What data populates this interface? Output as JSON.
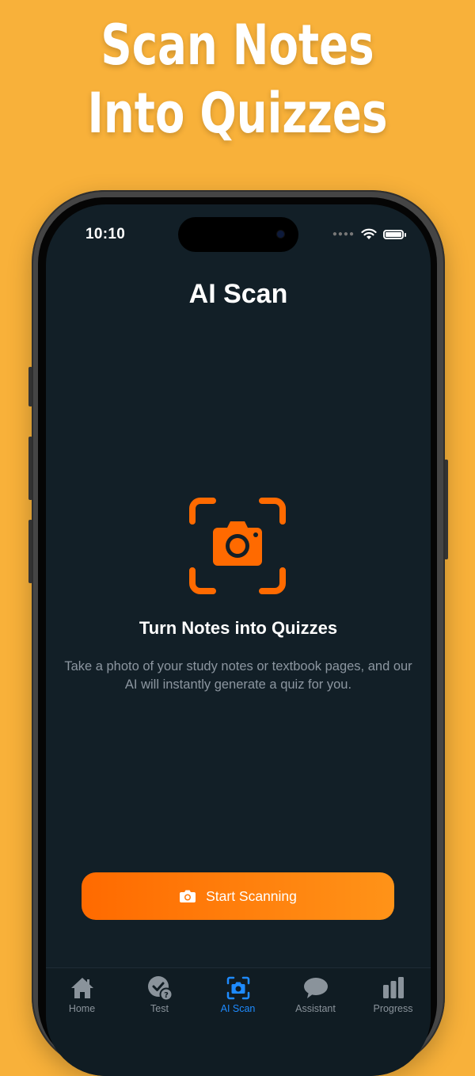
{
  "promo": {
    "line1": "Scan Notes",
    "line2": "Into Quizzes"
  },
  "status_bar": {
    "time": "10:10",
    "icons": [
      "signal-dots",
      "wifi-icon",
      "battery-icon"
    ]
  },
  "header": {
    "title": "AI Scan"
  },
  "content": {
    "icon": "camera-scan-icon",
    "title": "Turn Notes into Quizzes",
    "description": "Take a photo of your study notes or textbook pages, and our AI will instantly generate a quiz for you."
  },
  "primary_button": {
    "label": "Start Scanning",
    "icon": "camera-icon"
  },
  "tabs": [
    {
      "label": "Home",
      "icon": "home-icon",
      "active": false
    },
    {
      "label": "Test",
      "icon": "test-check-icon",
      "active": false
    },
    {
      "label": "AI Scan",
      "icon": "camera-scan-icon",
      "active": true
    },
    {
      "label": "Assistant",
      "icon": "chat-bubble-icon",
      "active": false
    },
    {
      "label": "Progress",
      "icon": "bar-chart-icon",
      "active": false
    }
  ],
  "colors": {
    "background": "#F8B13A",
    "screen": "#121F27",
    "accent": "#FF6A00",
    "active_tab": "#1E8BFF"
  }
}
